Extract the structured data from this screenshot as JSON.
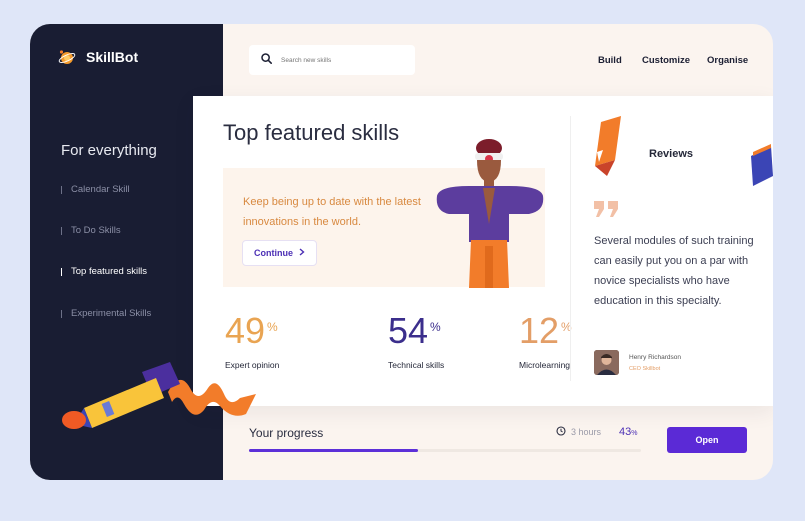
{
  "brand": {
    "name": "SkillBot",
    "accent": "#5b2ad6",
    "orange": "#f27c2a",
    "navy": "#191d33"
  },
  "sidebar": {
    "heading": "For everything",
    "items": [
      {
        "label": "Calendar Skill",
        "active": false
      },
      {
        "label": "To Do Skills",
        "active": false
      },
      {
        "label": "Top featured skills",
        "active": true
      },
      {
        "label": "Experimental Skills",
        "active": false
      }
    ]
  },
  "search": {
    "placeholder": "Search new skills",
    "icon": "search-icon"
  },
  "nav": {
    "items": [
      "Build",
      "Customize",
      "Organise"
    ]
  },
  "main": {
    "title": "Top featured skills",
    "promo": {
      "text": "Keep being up to date with the latest innovations in the world.",
      "button_label": "Continue",
      "button_icon": "chevron-right-icon"
    },
    "stats": [
      {
        "value": "49",
        "unit": "%",
        "label": "Expert opinion",
        "color": "#e9a452"
      },
      {
        "value": "54",
        "unit": "%",
        "label": "Technical skills",
        "color": "#3b2e8c"
      },
      {
        "value": "12",
        "unit": "%",
        "label": "Microlearning",
        "color": "#e39e67"
      }
    ]
  },
  "reviews": {
    "title": "Reviews",
    "quote_icon": "quote-icon",
    "text": "Several modules of such training can easily put you on a par with novice specialists who have education in this specialty.",
    "reviewer_name": "Henry Richardson",
    "reviewer_role": "CEO Skillbot"
  },
  "progress": {
    "title": "Your progress",
    "time": "3 hours",
    "percent": "43",
    "percent_unit": "%",
    "value": 0.43,
    "button_label": "Open"
  }
}
